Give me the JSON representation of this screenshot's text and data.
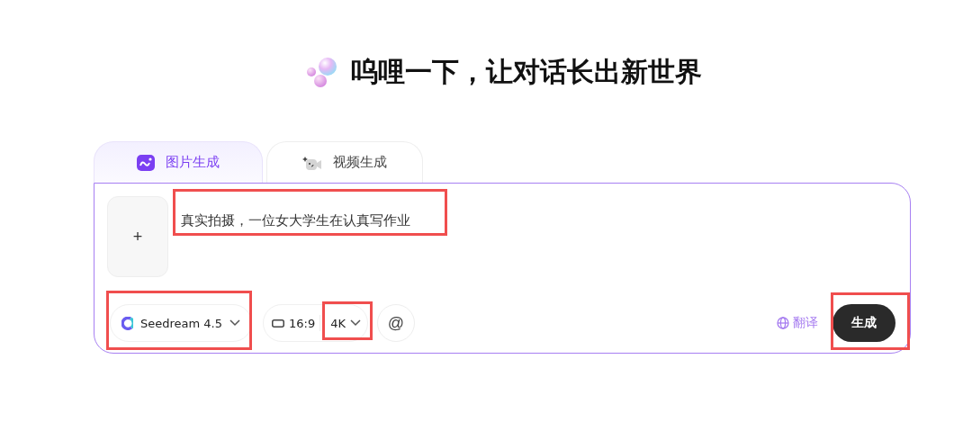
{
  "heading": "呜哩一下，让对话长出新世界",
  "tabs": [
    {
      "label": "图片生成",
      "selected": true,
      "kind": "image"
    },
    {
      "label": "视频生成",
      "selected": false,
      "kind": "video"
    }
  ],
  "upload": {
    "label": "+"
  },
  "prompt": {
    "value": "真实拍摄，一位女大学生在认真写作业"
  },
  "toolbar": {
    "model": "Seedream 4.5",
    "ratio": "16:9",
    "resolution": "4K",
    "mention": "@",
    "translate": "翻译",
    "generate": "生成"
  }
}
